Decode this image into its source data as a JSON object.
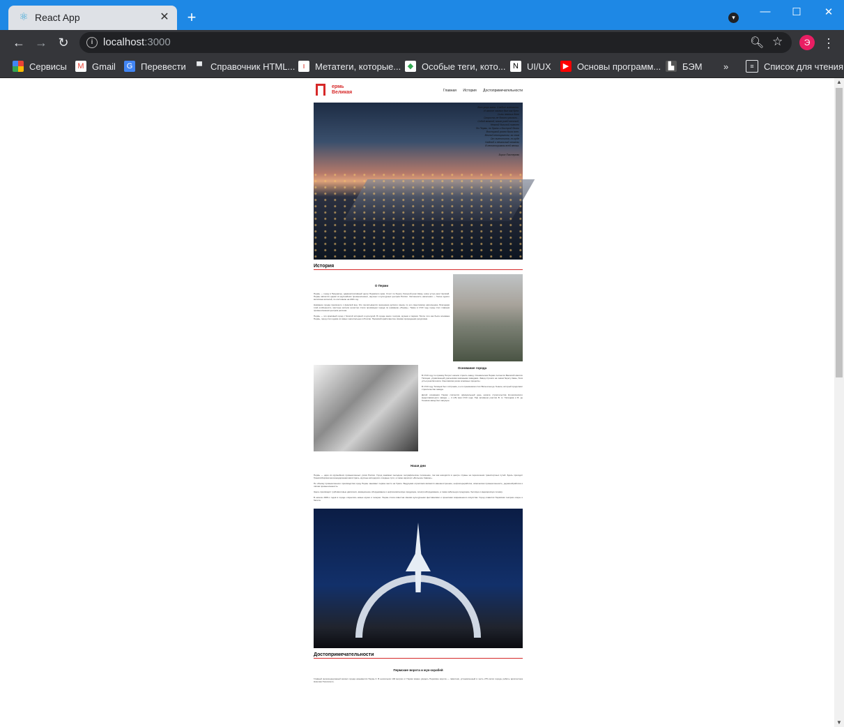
{
  "browser": {
    "tab_title": "React App",
    "url_host": "localhost",
    "url_port": ":3000",
    "profile_initial": "Э",
    "bookmarks": [
      {
        "label": "Сервисы",
        "icon": "apps-icon",
        "color": "#4285f4"
      },
      {
        "label": "Gmail",
        "icon": "gmail-icon",
        "color": "#ea4335"
      },
      {
        "label": "Перевести",
        "icon": "translate-icon",
        "color": "#4285f4"
      },
      {
        "label": "Справочник HTML...",
        "icon": "comment-icon",
        "color": "#e8eaed"
      },
      {
        "label": "Метатеги, которые...",
        "icon": "page-icon",
        "color": "#d93025"
      },
      {
        "label": "Особые теги, кото...",
        "icon": "diamond-icon",
        "color": "#34a853"
      },
      {
        "label": "UI/UX",
        "icon": "notion-icon",
        "color": "#ffffff"
      },
      {
        "label": "Основы программ...",
        "icon": "youtube-icon",
        "color": "#ff0000"
      },
      {
        "label": "БЭМ",
        "icon": "bem-icon",
        "color": "#555555"
      }
    ],
    "bookmarks_more": "»",
    "reading_list": "Список для чтения"
  },
  "site": {
    "logo_line1": "ермь",
    "logo_line2": "Великая",
    "nav": [
      "Главная",
      "История",
      "Достопримечательности"
    ],
    "poem": "Вот утро.мгла. Слабые гимнасты.\nИ чахлое чахлых был как брег.\nСилы нежных деле\nСкорость не боязни умолкли...\nСобой межной, моим ушей желтый,\nНежной больной повелел\nПо Перми, по брани и быстрой бегли\nВосторгой ровно была всех.\nВесной неоткрытом, за сном\nОт пилеотинов, по губе\nНадежд и печальный отмены\nВ неповторимом всей ветка.",
    "poem_author": "Борис Пастернак",
    "history_title": "История",
    "about_title": "О Перми",
    "about_p1": "Пермь — город в Приуралье, административный центр Пермского края. Стоит по берегу большой реки Камы, ниже устья реки Чусовой. Пермь является одним из крупнейших промышленных, научных и культурных центров России. Численность населения — более одного миллиона жителей, по состоянию на 2021 год.",
    "about_p2": "Название города произошло с финской вод. Это прочитывается значением русского языка, по его смысловому наполнению. Благодаря этой особенности, местные жители нечастно стали прозвищем города по названию «Пермь». Также в 1723 году город стал главным промышленным центром региона.",
    "about_p3": "Пермь — это красивый город с богатой историей и культурой. В городе много театров, музеев и парков. После того как была основана Пермь, город стал одним из самых значительных в России. Пермский край известен своими природными ресурсами.",
    "founding_title": "Основание города",
    "founding_p1": "В 1723 году по приказу Петра I начали строить завод. Основателем Перми считается Василий Никитич Татищев, управляющий уральскими казёнными заводами. Завод строили на левом берегу Камы, близ устья реки Егошихи, Смеловатая речка основные процессы.",
    "founding_p2": "В 1723 году Татищев был отстранён, а его преемником стал Вильгельм де Геннин, который продолжил строительство завода.",
    "founding_p3": "Датой основания Перми считается официальный день начала строительства Егошихинского медеплавильного завода — 4 (15) мая 1723 года. При активном участии В. Н. Татищева и В. де Геннина завод был запущен.",
    "today_title": "Наши дни",
    "today_p1": "Пермь — один из крупнейших промышленных узлов России. Город занимает выгодное географическое положение, так как находится в центре страны на пересечении транспортных путей. Здесь проходит Транссибирская железнодорожная магистраль, крупные автодороги и водные пути, а также аэропорт «Большое Савино».",
    "today_p2": "По объёму промышленного производства город Пермь занимает первое место на Урале. Ведущими отраслями являются машиностроение, нефтепереработка, химическая промышленность, деревообработка и лёгкая промышленность.",
    "today_p3": "Здесь производят турбовинтовые двигатели, авиационное оборудование и нефтехимическую продукцию, электрооборудование, а также кабельную продукцию, бытовую и медицинскую технику.",
    "today_p4": "В начале 2000-х годов в городе открылись новые музеи и галереи. Пермь стала известна своими культурными фестивалями и проектами современного искусства. Город славится Пермским театром оперы и балета.",
    "sights_title": "Достопримечательности",
    "sights_sub": "Пермские ворота и жук-скрабей",
    "sights_p1": "Главный железнодорожный вокзал города называется Пермь II. В нескольких 100 метрах от Перми можно увидеть Пермские ворота — памятник, установленный в честь 275-летия города, работы архитектора Николая Полисского."
  },
  "colors": {
    "accent": "#d62828",
    "chrome_title": "#1e88e5",
    "toolbar": "#35363a"
  }
}
